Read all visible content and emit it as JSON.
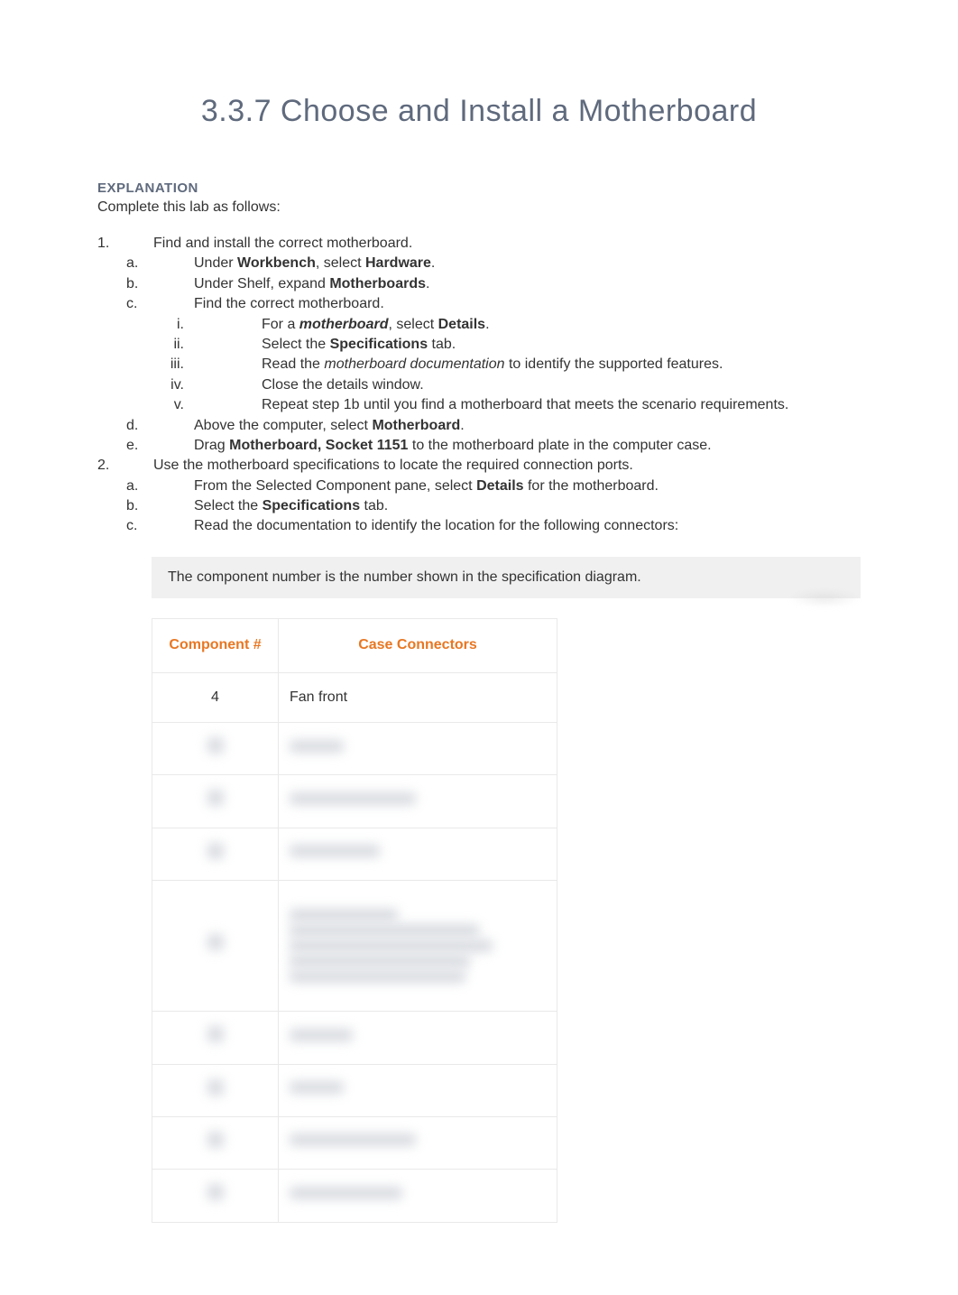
{
  "title": "3.3.7 Choose and Install a Motherboard",
  "explanation_label": "EXPLANATION",
  "intro": "Complete this lab as follows:",
  "step1": {
    "text": "Find and install the correct motherboard.",
    "a": {
      "pre": "Under ",
      "b1": "Workbench",
      "mid": ", select ",
      "b2": "Hardware",
      "post": "."
    },
    "b": {
      "pre": "Under Shelf, expand ",
      "b1": "Motherboards",
      "post": "."
    },
    "c": {
      "text": "Find the correct motherboard.",
      "i": {
        "pre": "For a ",
        "em": "motherboard",
        "mid": ", select ",
        "b1": "Details",
        "post": "."
      },
      "ii": {
        "pre": "Select the ",
        "b1": "Specifications",
        "post": " tab."
      },
      "iii": {
        "pre": "Read the ",
        "em": "motherboard documentation",
        "post": " to identify the supported features."
      },
      "iv": "Close the details window.",
      "v": "Repeat step 1b until you find a motherboard that meets the scenario requirements."
    },
    "d": {
      "pre": "Above the computer, select ",
      "b1": "Motherboard",
      "post": "."
    },
    "e": {
      "pre": "Drag ",
      "b1": "Motherboard, Socket 1151",
      "post": " to the motherboard plate in the computer case."
    }
  },
  "step2": {
    "text": "Use the motherboard specifications to locate the required connection ports.",
    "a": {
      "pre": "From the Selected Component pane, select ",
      "b1": "Details",
      "post": " for the motherboard."
    },
    "b": {
      "pre": "Select the ",
      "b1": "Specifications",
      "post": " tab."
    },
    "c": "Read the documentation to identify the location for the following connectors:"
  },
  "note": "The component number is the number shown in the specification diagram.",
  "table": {
    "header_component": "Component #",
    "header_connectors": "Case Connectors",
    "rows": [
      {
        "num": "4",
        "text": "Fan front",
        "blurred": false
      },
      {
        "num": "•",
        "text": "••• •••",
        "blurred": true
      },
      {
        "num": "•",
        "text": "•••• ••• •••••••••",
        "blurred": true
      },
      {
        "num": "•",
        "text": "••••• ••••••",
        "blurred": true
      },
      {
        "num": "•",
        "text": "multiline",
        "blurred": true,
        "tall": true
      },
      {
        "num": "•",
        "text": "•••• •••",
        "blurred": true
      },
      {
        "num": "•",
        "text": "•••••••",
        "blurred": true
      },
      {
        "num": "•",
        "text": "•••• ••• •••••••••",
        "blurred": true
      },
      {
        "num": "•",
        "text": "•••• •••••• •••••",
        "blurred": true
      }
    ]
  }
}
